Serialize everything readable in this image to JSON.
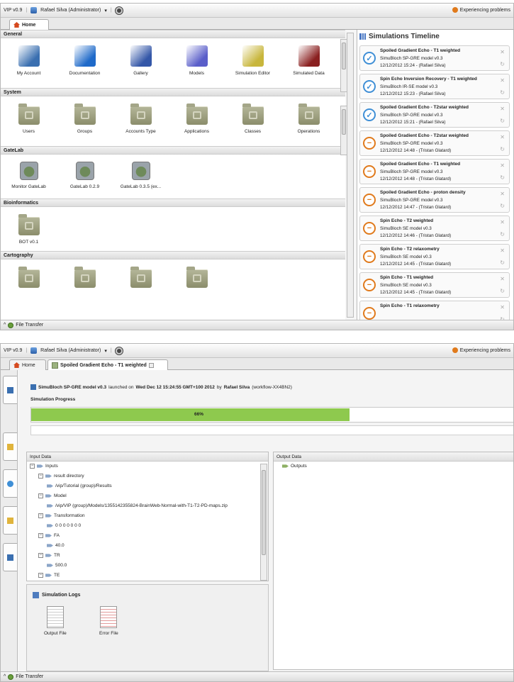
{
  "topbar": {
    "app": "VIP v0.9",
    "user": "Rafael Silva (Administrator)",
    "caret": "▾",
    "separator": "|",
    "problems": "Experiencing problems"
  },
  "screen1": {
    "tab_home": "Home",
    "sections": [
      {
        "title": "General",
        "items": [
          "My Account",
          "Documentation",
          "Gallery",
          "Models",
          "Simulation Editor",
          "Simulated Data"
        ]
      },
      {
        "title": "System",
        "items": [
          "Users",
          "Groups",
          "Accounts Type",
          "Applications",
          "Classes",
          "Operations"
        ]
      },
      {
        "title": "GateLab",
        "items": [
          "Monitor GateLab",
          "GateLab 0.2.9",
          "GateLab 0.3.5 (ex..."
        ]
      },
      {
        "title": "Bioinformatics",
        "items": [
          "BOT v0.1"
        ]
      },
      {
        "title": "Cartography",
        "items": []
      }
    ],
    "timeline_title": "Simulations Timeline",
    "timeline": [
      {
        "name": "Spoiled Gradient Echo - T1 weighted",
        "model": "SimuBloch SP-GRE model v0.3",
        "date": "12/12/2012 15:24 - (Rafael Silva)",
        "state": "done"
      },
      {
        "name": "Spin Echo Inversion Recovery - T1 weighted",
        "model": "SimuBloch IR-SE model v0.3",
        "date": "12/12/2012 15:23 - (Rafael Silva)",
        "state": "done"
      },
      {
        "name": "Spoiled Gradient Echo - T2star weighted",
        "model": "SimuBloch SP-GRE model v0.3",
        "date": "12/12/2012 15:21 - (Rafael Silva)",
        "state": "done"
      },
      {
        "name": "Spoiled Gradient Echo - T2star weighted",
        "model": "SimuBloch SP-GRE model v0.3",
        "date": "12/12/2012 14:48 - (Tristan Glatard)",
        "state": "running"
      },
      {
        "name": "Spoiled Gradient Echo - T1 weighted",
        "model": "SimuBloch SP-GRE model v0.3",
        "date": "12/12/2012 14:48 - (Tristan Glatard)",
        "state": "running"
      },
      {
        "name": "Spoiled Gradient Echo - proton density",
        "model": "SimuBloch SP-GRE model v0.3",
        "date": "12/12/2012 14:47 - (Tristan Glatard)",
        "state": "running"
      },
      {
        "name": "Spin Echo - T2 weighted",
        "model": "SimuBloch SE model v0.3",
        "date": "12/12/2012 14:46 - (Tristan Glatard)",
        "state": "running"
      },
      {
        "name": "Spin Echo - T2 relaxometry",
        "model": "SimuBloch SE model v0.3",
        "date": "12/12/2012 14:45 - (Tristan Glatard)",
        "state": "running"
      },
      {
        "name": "Spin Echo - T1 weighted",
        "model": "SimuBloch SE model v0.3",
        "date": "12/12/2012 14:45 - (Tristan Glatard)",
        "state": "running"
      },
      {
        "name": "Spin Echo - T1 relaxometry",
        "model": "",
        "date": "",
        "state": "running"
      }
    ],
    "file_transfer": "File Transfer"
  },
  "screen2": {
    "tab_home": "Home",
    "tab_sim": "Spoiled Gradient Echo - T1 weighted",
    "launch": {
      "model": "SimuBloch SP-GRE model v0.3",
      "t1": "launched on",
      "date": "Wed Dec 12 15:24:55 GMT+100 2012",
      "t2": "by",
      "user": "Rafael Silva",
      "workflow": "(workflow-XX4BN2)"
    },
    "progress_label": "Simulation Progress",
    "progress_text": "66%",
    "progress_value": 0.66,
    "input_header": "Input Data",
    "output_header": "Output Data",
    "input_tree": [
      {
        "label": "Inputs",
        "level": 0,
        "toggle": "−"
      },
      {
        "label": "result directory",
        "level": 1,
        "toggle": "−"
      },
      {
        "label": "/vip/Tutorial (group)/Results",
        "level": 2,
        "toggle": ""
      },
      {
        "label": "Model",
        "level": 1,
        "toggle": "−"
      },
      {
        "label": "/vip/VIP (group)/Models/1355142355824-BrainWeb-Normal-with-T1-T2-PD-maps.zip",
        "level": 2,
        "toggle": ""
      },
      {
        "label": "Transformation",
        "level": 1,
        "toggle": "−"
      },
      {
        "label": "0 0 0 0 0 0 0",
        "level": 2,
        "toggle": ""
      },
      {
        "label": "FA",
        "level": 1,
        "toggle": "−"
      },
      {
        "label": "40.0",
        "level": 2,
        "toggle": ""
      },
      {
        "label": "TR",
        "level": 1,
        "toggle": "−"
      },
      {
        "label": "500.0",
        "level": 2,
        "toggle": ""
      },
      {
        "label": "TE",
        "level": 1,
        "toggle": "−"
      }
    ],
    "output_tree": [
      "Outputs"
    ],
    "logs_title": "Simulation Logs",
    "logs": [
      "Output File",
      "Error File"
    ],
    "file_transfer": "File Transfer"
  },
  "colors": {
    "progress": "#8ec94e",
    "done": "#3f8fd6",
    "running": "#e07a1c"
  }
}
